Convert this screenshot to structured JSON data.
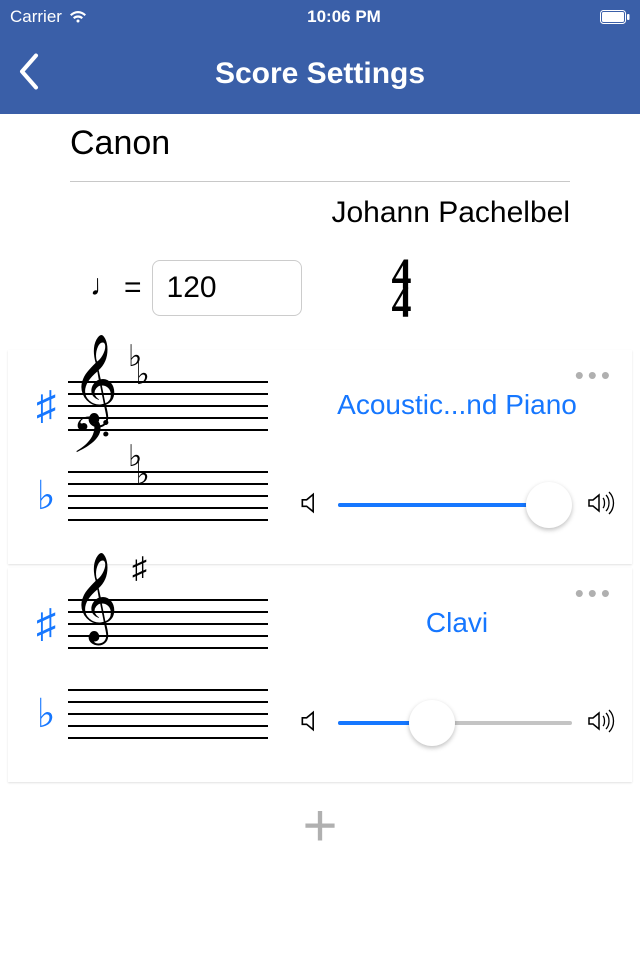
{
  "status": {
    "carrier": "Carrier",
    "time": "10:06 PM"
  },
  "nav": {
    "title": "Score Settings"
  },
  "score": {
    "title": "Canon",
    "composer": "Johann Pachelbel",
    "tempo": "120",
    "time_sig_top": "4",
    "time_sig_bottom": "4"
  },
  "instruments": [
    {
      "name": "Acoustic...nd Piano",
      "top_accidental": "♯",
      "bottom_accidental": "♭",
      "clef_top": "treble",
      "clef_bottom": "bass",
      "key_sig_top": "♭♭",
      "key_sig_bottom": "♭♭",
      "volume_percent": 90
    },
    {
      "name": "Clavi",
      "top_accidental": "♯",
      "bottom_accidental": "♭",
      "clef_top": "treble",
      "clef_bottom": "none",
      "key_sig_top": "♯",
      "key_sig_bottom": "",
      "volume_percent": 40
    }
  ],
  "icons": {
    "more": "•••",
    "add": "+"
  }
}
